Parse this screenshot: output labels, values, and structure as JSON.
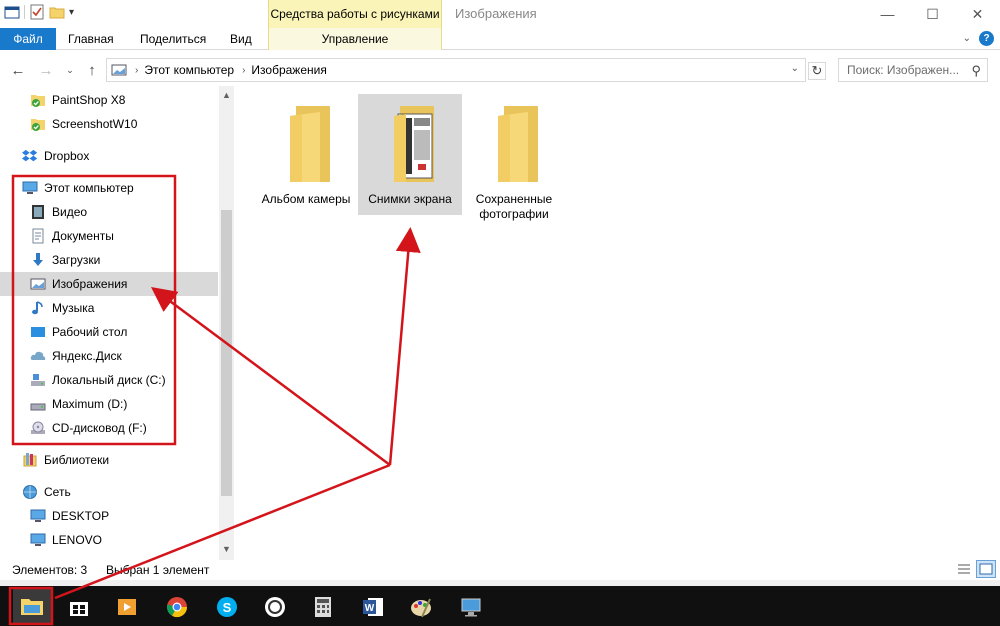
{
  "window": {
    "title": "Изображения",
    "tools_tab": "Средства работы с рисунками",
    "controls": {
      "minimize": "—",
      "maximize": "☐",
      "close": "✕"
    }
  },
  "ribbon": {
    "file": "Файл",
    "home": "Главная",
    "share": "Поделиться",
    "view": "Вид",
    "manage": "Управление"
  },
  "address": {
    "crumbs": [
      "Этот компьютер",
      "Изображения"
    ],
    "search_placeholder": "Поиск: Изображен..."
  },
  "nav": {
    "items": [
      {
        "label": "PaintShop X8",
        "icon": "synced-folder-icon"
      },
      {
        "label": "ScreenshotW10",
        "icon": "synced-folder-icon"
      },
      {
        "label": "Dropbox",
        "icon": "dropbox-icon"
      },
      {
        "label": "Этот компьютер",
        "icon": "computer-icon"
      },
      {
        "label": "Видео",
        "icon": "video-icon"
      },
      {
        "label": "Документы",
        "icon": "documents-icon"
      },
      {
        "label": "Загрузки",
        "icon": "download-icon"
      },
      {
        "label": "Изображения",
        "icon": "pictures-icon"
      },
      {
        "label": "Музыка",
        "icon": "music-icon"
      },
      {
        "label": "Рабочий стол",
        "icon": "desktop-icon"
      },
      {
        "label": "Яндекс.Диск",
        "icon": "cloud-icon"
      },
      {
        "label": "Локальный диск (C:)",
        "icon": "drive-icon"
      },
      {
        "label": "Maximum (D:)",
        "icon": "drive-icon"
      },
      {
        "label": "CD-дисковод (F:)",
        "icon": "cd-drive-icon"
      },
      {
        "label": "Библиотеки",
        "icon": "libraries-icon"
      },
      {
        "label": "Сеть",
        "icon": "network-icon"
      },
      {
        "label": "DESKTOP",
        "icon": "pc-icon"
      },
      {
        "label": "LENOVO",
        "icon": "pc-icon"
      }
    ]
  },
  "content": {
    "folders": [
      {
        "label": "Альбом камеры"
      },
      {
        "label": "Снимки экрана"
      },
      {
        "label": "Сохраненные фотографии"
      }
    ]
  },
  "status": {
    "count": "Элементов: 3",
    "selected": "Выбран 1 элемент"
  },
  "taskbar": {
    "apps": [
      "file-explorer-icon",
      "store-icon",
      "media-player-icon",
      "chrome-icon",
      "skype-icon",
      "fotor-icon",
      "calculator-icon",
      "word-icon",
      "paint-icon",
      "remote-desktop-icon"
    ]
  },
  "colors": {
    "accent": "#1979ca",
    "tools_tab": "#fbf4b8",
    "selection": "#d9d9d9",
    "annotation": "#d4141b",
    "folder": "#f5d36b"
  }
}
